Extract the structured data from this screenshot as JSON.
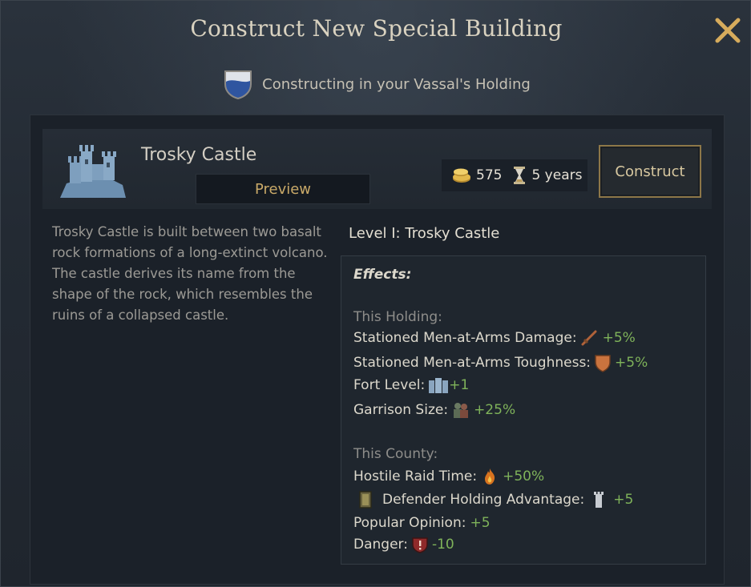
{
  "window": {
    "title": "Construct New Special Building",
    "subtitle": "Constructing in your Vassal's Holding",
    "accent_gold": "#c9a968",
    "positive_green": "#7fb35a"
  },
  "building": {
    "name": "Trosky Castle",
    "icon": "castle-icon",
    "preview_label": "Preview",
    "gold_cost": "575",
    "build_time": "5 years",
    "construct_label": "Construct",
    "description": "Trosky Castle is built between two basalt rock formations of a long-extinct volcano. The castle derives its name from the shape of the rock, which resembles the ruins of a collapsed castle."
  },
  "level": {
    "prefix": "Level I:",
    "name": "Trosky Castle"
  },
  "effects": {
    "label": "Effects:",
    "holding_header": "This Holding:",
    "holding": [
      {
        "label": "Stationed Men-at-Arms Damage:",
        "icon": "sword-icon",
        "value": "+5%"
      },
      {
        "label": "Stationed Men-at-Arms Toughness:",
        "icon": "shield-icon",
        "value": "+5%"
      },
      {
        "label": "Fort Level:",
        "icon": "fort-icon",
        "value": "+1"
      },
      {
        "label": "Garrison Size:",
        "icon": "soldiers-icon",
        "value": "+25%"
      }
    ],
    "county_header": "This County:",
    "county": [
      {
        "label": "Hostile Raid Time:",
        "icon": "fire-icon",
        "value": "+50%"
      },
      {
        "label": "Defender Holding Advantage:",
        "icon": "tower-icon",
        "value": "+5",
        "prefix_icon": "banner-icon"
      },
      {
        "label": "Popular Opinion:",
        "value": "+5"
      },
      {
        "label": "Danger:",
        "icon": "danger-icon",
        "value": "-10"
      }
    ]
  }
}
